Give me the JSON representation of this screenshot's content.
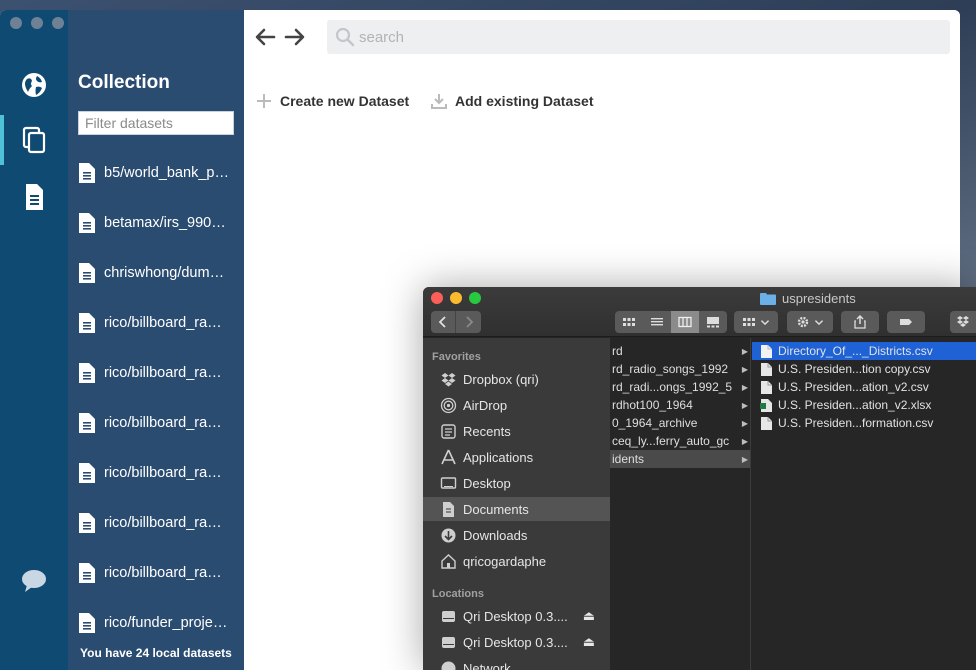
{
  "app": {
    "sidebar": {
      "title": "Collection",
      "filter_placeholder": "Filter datasets",
      "datasets": [
        {
          "label": "b5/world_bank_p…"
        },
        {
          "label": "betamax/irs_990…"
        },
        {
          "label": "chriswhong/dum…"
        },
        {
          "label": "rico/billboard_ra…"
        },
        {
          "label": "rico/billboard_ra…"
        },
        {
          "label": "rico/billboard_ra…"
        },
        {
          "label": "rico/billboard_ra…"
        },
        {
          "label": "rico/billboard_ra…"
        },
        {
          "label": "rico/billboard_ra…"
        },
        {
          "label": "rico/funder_proje…"
        }
      ],
      "footer": "You have 24 local datasets"
    },
    "search_placeholder": "search",
    "actions": {
      "create": "Create new Dataset",
      "add_existing": "Add existing Dataset"
    },
    "colors": {
      "rail": "#0f4a73",
      "sidebar": "#2b4c71",
      "rail_active_accent": "#4fc2d9"
    },
    "icons": [
      "globe-icon",
      "collection-icon",
      "document-icon",
      "chat-icon"
    ]
  },
  "finder": {
    "title": "uspresidents",
    "favorites_header": "Favorites",
    "favorites": [
      {
        "label": "Dropbox (qri)",
        "icon": "dropbox-icon"
      },
      {
        "label": "AirDrop",
        "icon": "airdrop-icon"
      },
      {
        "label": "Recents",
        "icon": "clock-icon"
      },
      {
        "label": "Applications",
        "icon": "applications-icon"
      },
      {
        "label": "Desktop",
        "icon": "desktop-icon"
      },
      {
        "label": "Documents",
        "icon": "documents-icon"
      },
      {
        "label": "Downloads",
        "icon": "downloads-icon"
      },
      {
        "label": "qricogardaphe",
        "icon": "home-icon"
      }
    ],
    "locations_header": "Locations",
    "locations": [
      {
        "label": "Qri Desktop 0.3...."
      },
      {
        "label": "Qri Desktop 0.3...."
      },
      {
        "label": "Network"
      }
    ],
    "folders": [
      "rd",
      "rd_radio_songs_1992",
      "rd_radi...ongs_1992_5",
      "rdhot100_1964",
      "0_1964_archive",
      "ceq_ly...ferry_auto_gc",
      "idents"
    ],
    "files": [
      "Directory_Of_..._Districts.csv",
      "U.S. Presiden...tion copy.csv",
      "U.S. Presiden...ation_v2.csv",
      "U.S. Presiden...ation_v2.xlsx",
      "U.S. Presiden...formation.csv"
    ]
  }
}
